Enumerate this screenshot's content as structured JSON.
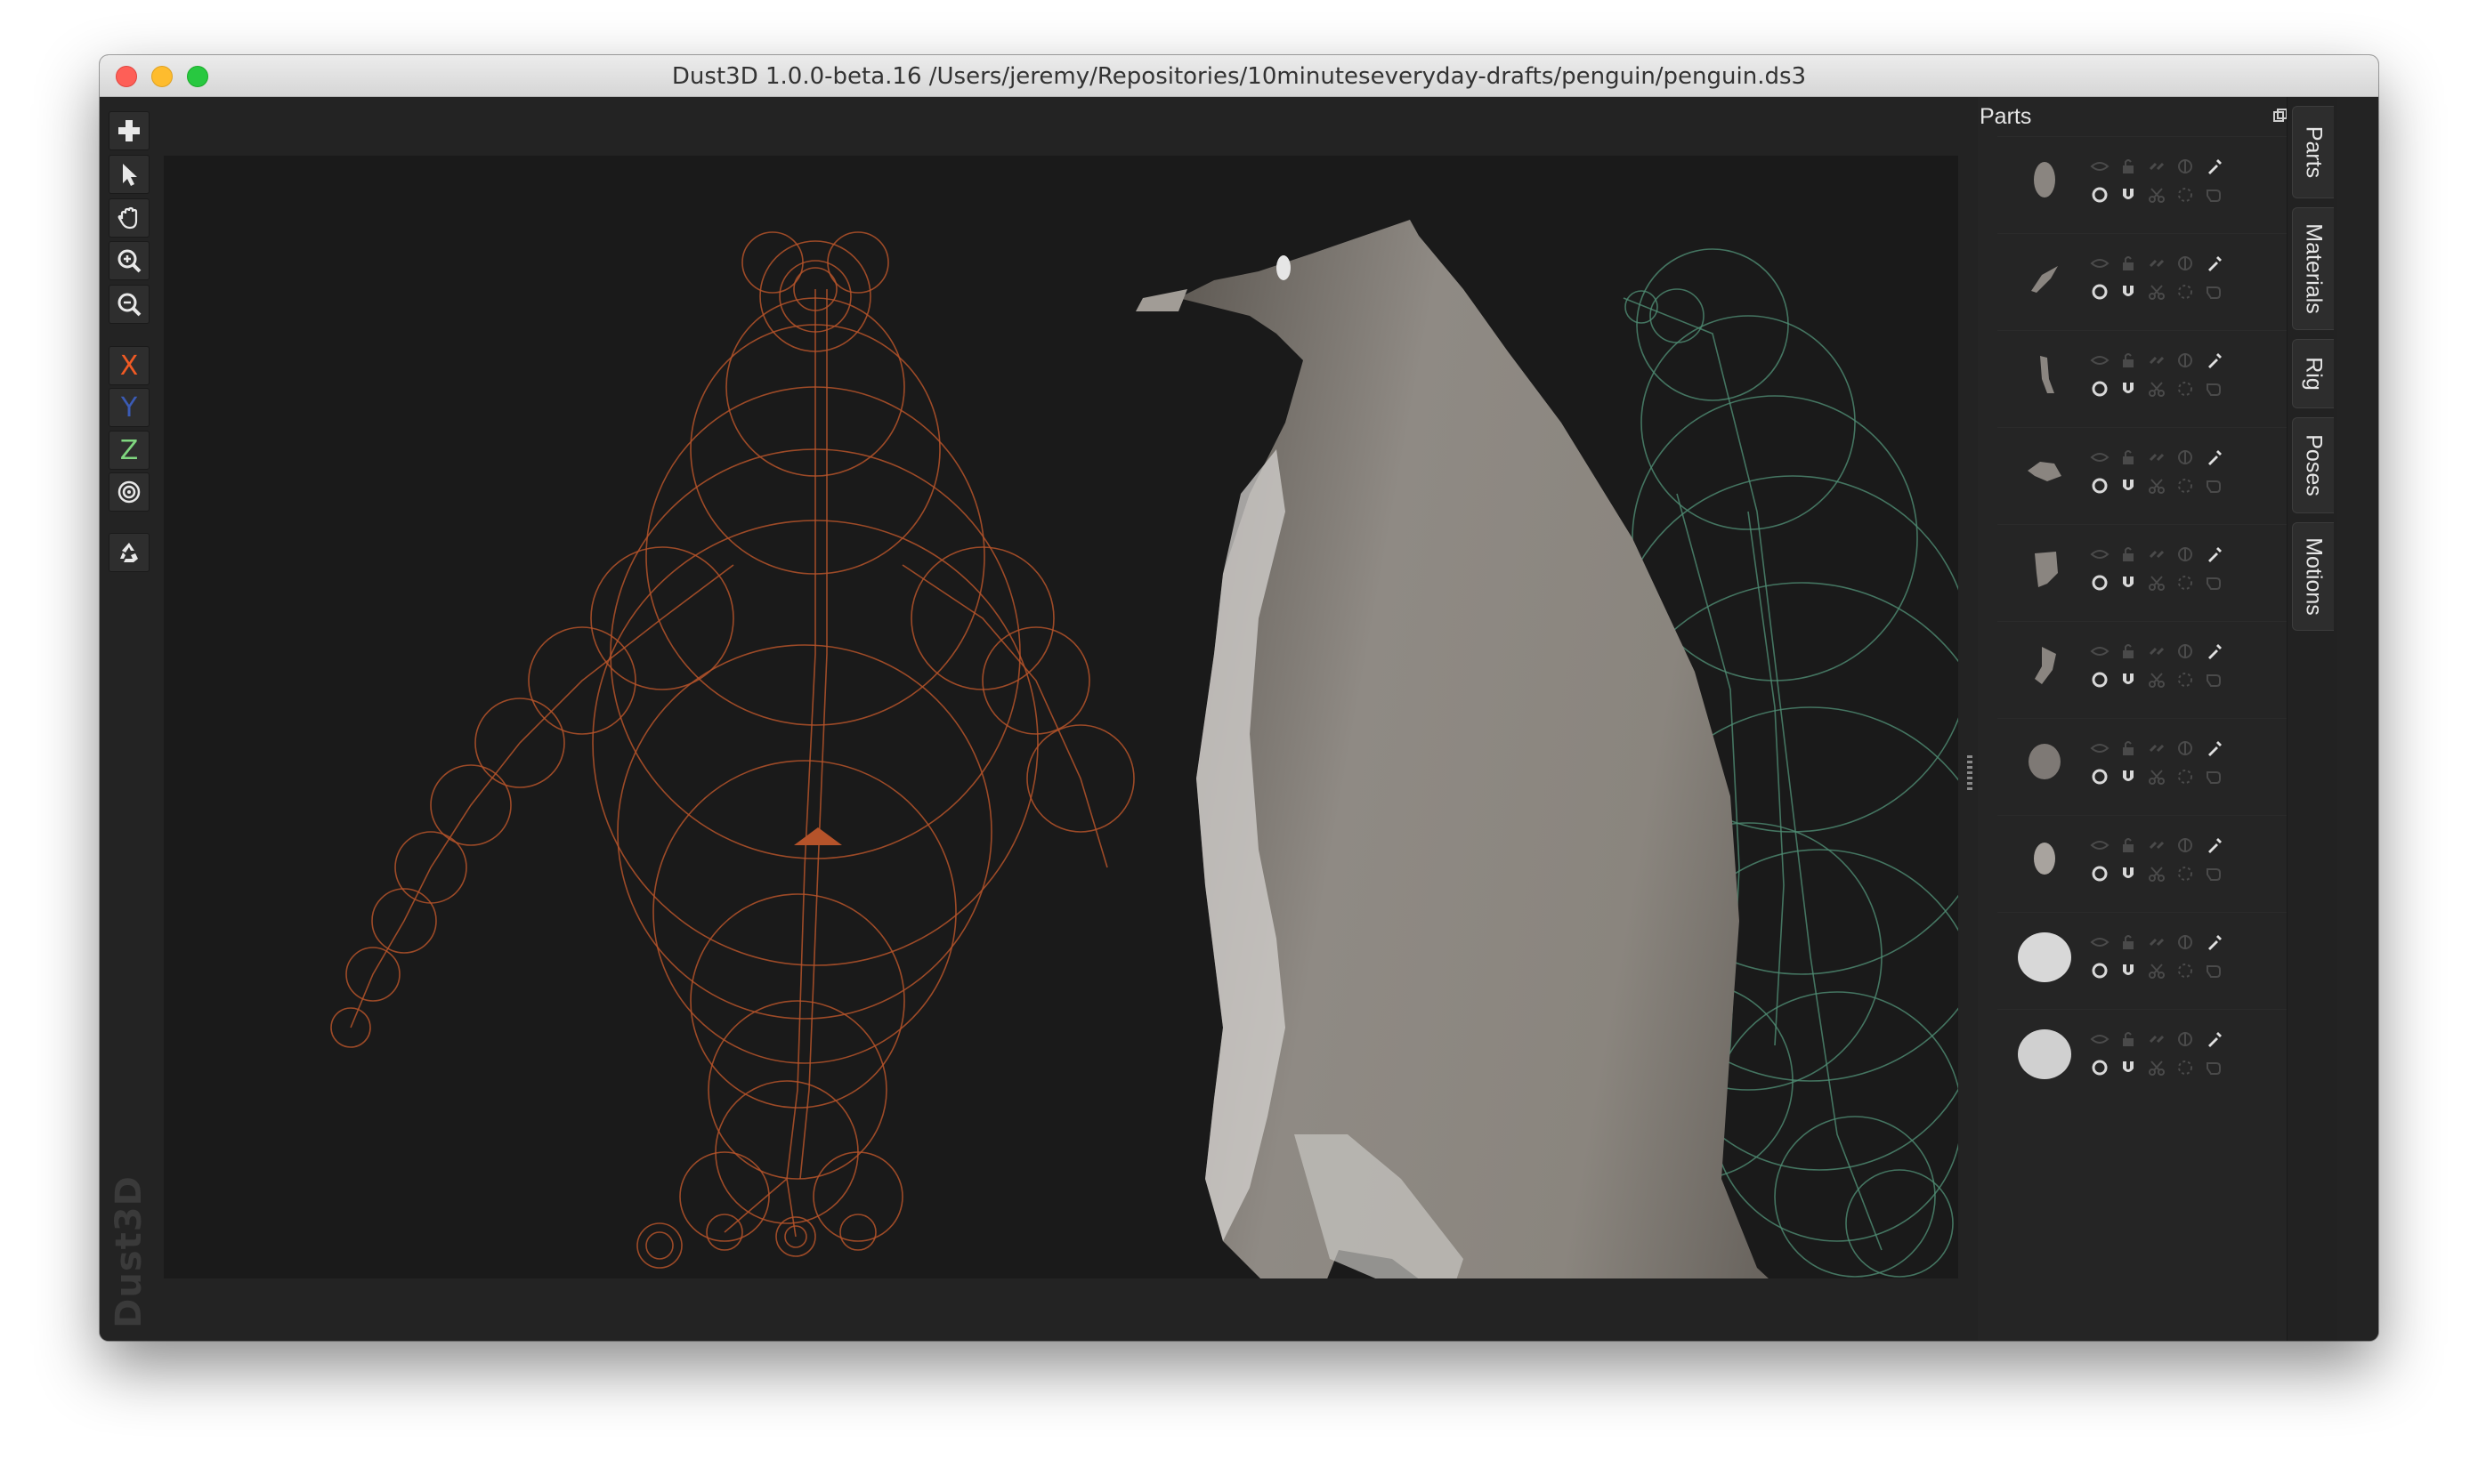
{
  "window": {
    "title": "Dust3D 1.0.0-beta.16 /Users/jeremy/Repositories/10minuteseveryday-drafts/penguin/penguin.ds3"
  },
  "toolbar": {
    "items": [
      {
        "name": "add-icon",
        "label": ""
      },
      {
        "name": "select-icon",
        "label": ""
      },
      {
        "name": "drag-hand-icon",
        "label": ""
      },
      {
        "name": "zoom-in-icon",
        "label": ""
      },
      {
        "name": "zoom-out-icon",
        "label": ""
      }
    ],
    "axes": [
      {
        "label": "X",
        "color": "#f05a24"
      },
      {
        "label": "Y",
        "color": "#3b5bb5"
      },
      {
        "label": "Z",
        "color": "#7fd67f"
      }
    ]
  },
  "watermark": "Dust3D",
  "parts_panel": {
    "title": "Parts",
    "rows": 10
  },
  "side_tabs": [
    {
      "label": "Parts"
    },
    {
      "label": "Materials"
    },
    {
      "label": "Rig"
    },
    {
      "label": "Poses"
    },
    {
      "label": "Motions"
    }
  ],
  "colors": {
    "front_view": "#c2572a",
    "side_view": "#4f8c73",
    "model": "#8e8882"
  }
}
